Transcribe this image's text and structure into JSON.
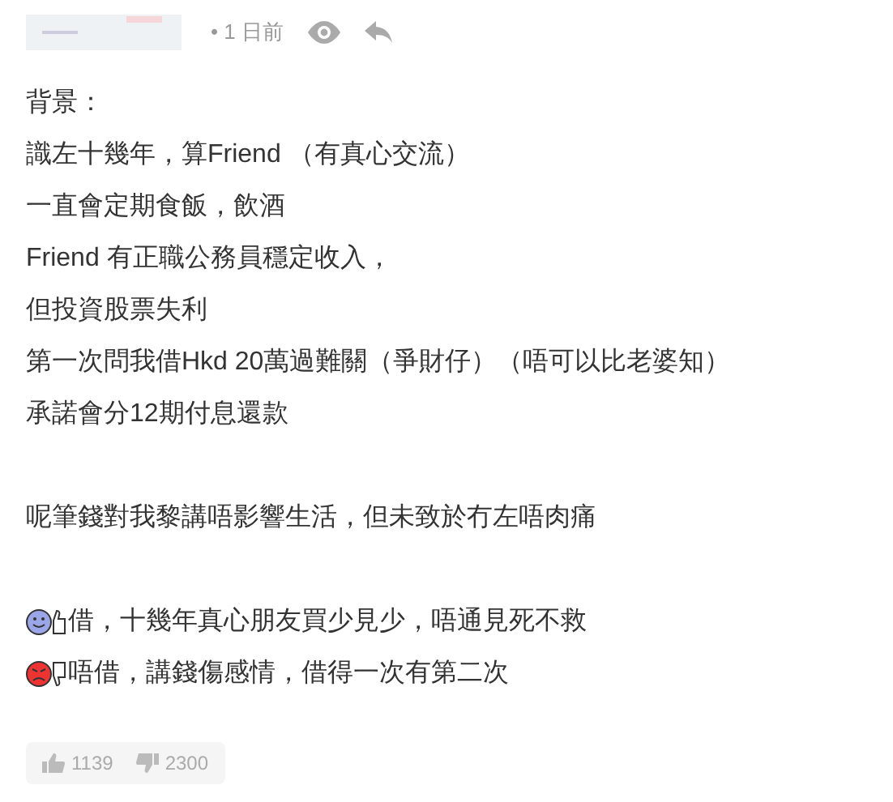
{
  "header": {
    "time": "• 1 日前"
  },
  "body": [
    [
      "背景：",
      "識左十幾年，算Friend （有真心交流）",
      "一直會定期食飯，飲酒",
      "Friend 有正職公務員穩定收入，",
      "但投資股票失利",
      "第一次問我借Hkd 20萬過難關（爭財仔）（唔可以比老婆知）",
      "承諾會分12期付息還款"
    ],
    [
      "呢筆錢對我黎講唔影響生活，但未致於冇左唔肉痛"
    ]
  ],
  "options": [
    {
      "kind": "agree",
      "text": "借，十幾年真心朋友買少見少，唔通見死不救"
    },
    {
      "kind": "disagree",
      "text": "唔借，講錢傷感情，借得一次有第二次"
    }
  ],
  "votes": {
    "likes": "1139",
    "dislikes": "2300"
  }
}
